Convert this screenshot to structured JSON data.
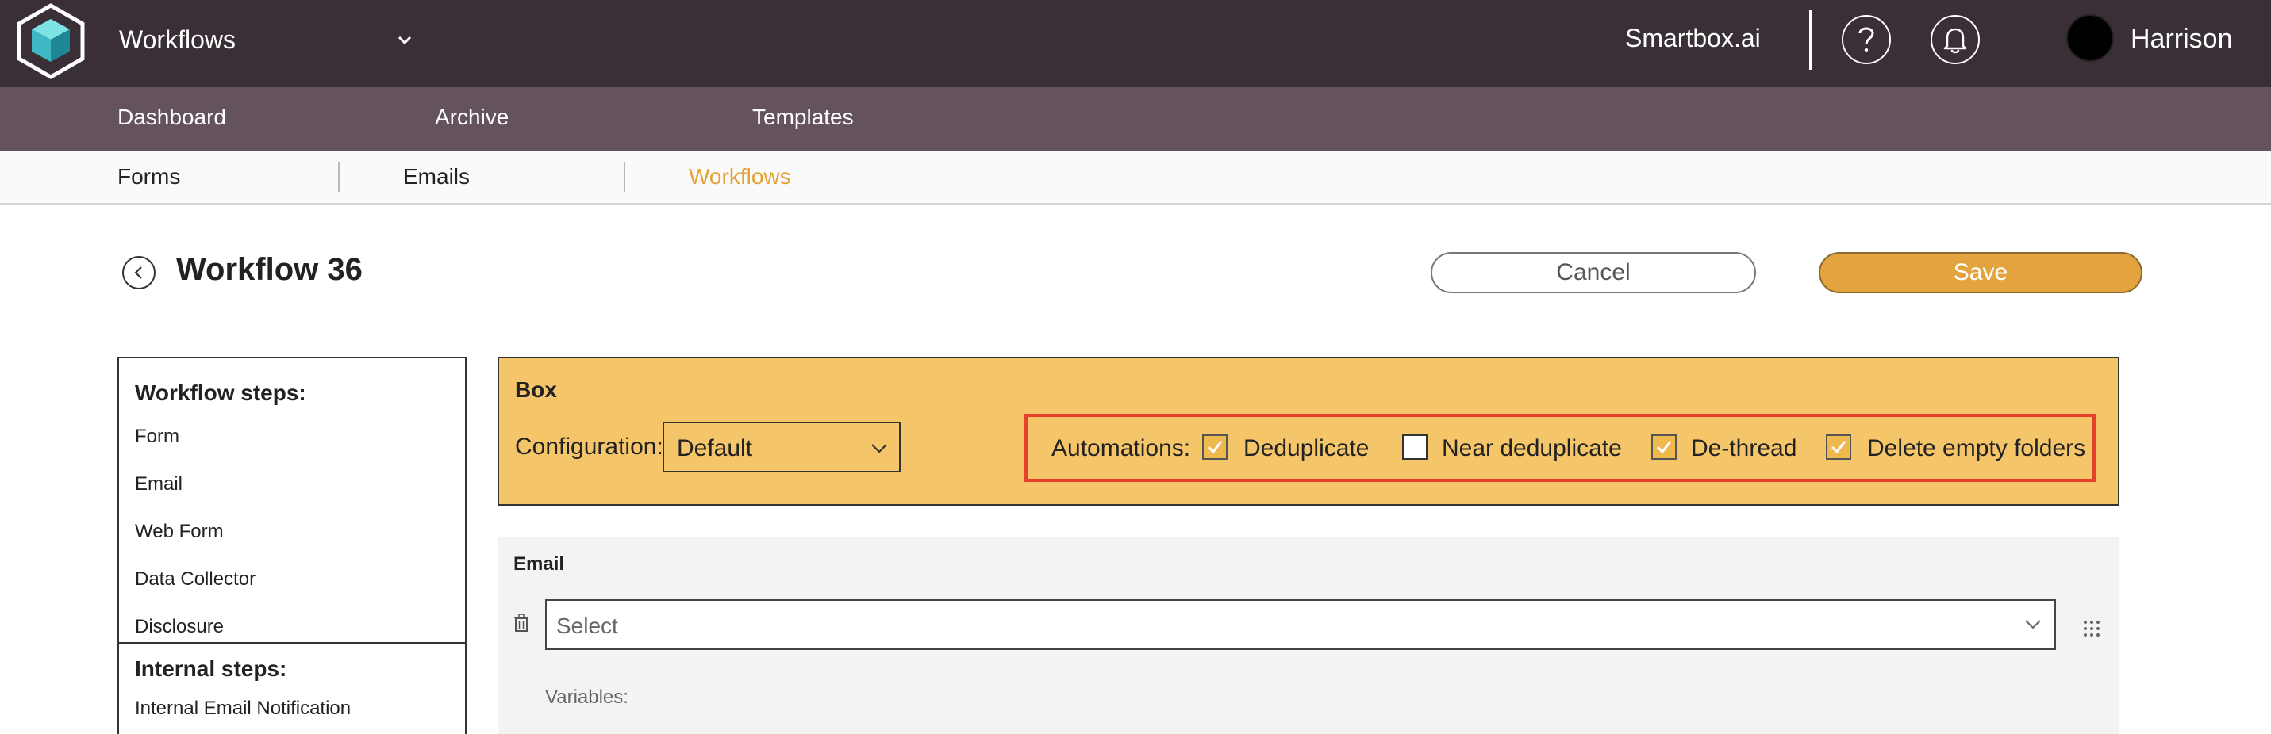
{
  "header": {
    "app_name": "Workflows",
    "brand": "Smartbox.ai",
    "username": "Harrison"
  },
  "main_nav": {
    "items": [
      "Dashboard",
      "Archive",
      "Templates"
    ]
  },
  "sub_nav": {
    "items": [
      "Forms",
      "Emails",
      "Workflows"
    ],
    "active": "Workflows"
  },
  "page": {
    "title": "Workflow 36",
    "cancel_label": "Cancel",
    "save_label": "Save"
  },
  "steps_panel": {
    "workflow_heading": "Workflow steps:",
    "workflow_steps": [
      "Form",
      "Email",
      "Web Form",
      "Data Collector",
      "Disclosure"
    ],
    "internal_heading": "Internal steps:",
    "internal_steps": [
      "Internal Email Notification"
    ]
  },
  "box_panel": {
    "title": "Box",
    "config_label": "Configuration:",
    "config_value": "Default",
    "automations_label": "Automations:",
    "automations": [
      {
        "label": "Deduplicate",
        "checked": true
      },
      {
        "label": "Near deduplicate",
        "checked": false
      },
      {
        "label": "De-thread",
        "checked": true
      },
      {
        "label": "Delete empty folders",
        "checked": true
      }
    ]
  },
  "email_panel": {
    "title": "Email",
    "select_placeholder": "Select",
    "variables_label": "Variables:"
  },
  "colors": {
    "topbar": "#3a2f37",
    "main_nav": "#64535f",
    "accent": "#e3a234",
    "box_bg": "#f5c56a",
    "highlight_border": "#e8412a"
  }
}
